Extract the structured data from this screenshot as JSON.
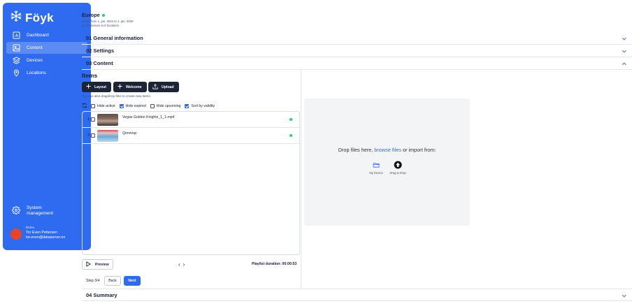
{
  "app": {
    "name": "Föyk"
  },
  "sidebar": {
    "items": [
      {
        "label": "Dashboard"
      },
      {
        "label": "Content"
      },
      {
        "label": "Devices"
      },
      {
        "label": "Locations"
      }
    ],
    "system": {
      "line1": "System",
      "line2": "management"
    },
    "user": {
      "org": "Demo",
      "name": "Tor Even Pettersen",
      "email": "tor.even@dataserver.no"
    }
  },
  "header": {
    "title": "Europe",
    "line1": "Active from 1. jan. 2024 to 1. jan. 2030",
    "line2": "on 10 devices in 8 locations"
  },
  "sections": {
    "s1": "01 General information",
    "s2": "02 Settings",
    "s3": "03 Content",
    "s4": "04 Summary"
  },
  "items": {
    "title": "Items",
    "buttons": {
      "layout": "Layout",
      "welcome": "Welcome",
      "upload": "Upload"
    },
    "helper": "You can also drag/drop files to create new items.",
    "filters": [
      {
        "label": "Hide active",
        "checked": false
      },
      {
        "label": "Hide expired",
        "checked": true
      },
      {
        "label": "Hide upcoming",
        "checked": false
      },
      {
        "label": "Sort by validity",
        "checked": true
      }
    ],
    "rows": [
      {
        "num": "1",
        "name": "Vegas Golden Knights_1_1.mp4"
      },
      {
        "num": "3",
        "name": "Qrevivqx"
      }
    ]
  },
  "footer": {
    "preview": "Preview",
    "prev": "‹",
    "next_page": "›",
    "duration": "Playlist duration: 00:00:53",
    "step": "Step 3/4",
    "back": "Back",
    "next": "Next"
  },
  "dropzone": {
    "prefix": "Drop files here,",
    "link": "browse files",
    "suffix": "or import from:",
    "sources": [
      {
        "label": "My Device"
      },
      {
        "label": "Drag & Drop"
      }
    ]
  },
  "colors": {
    "brand": "#2f6bf0",
    "dark": "#1c2536",
    "status": "#2ecc71",
    "avatar": "#e8442a"
  }
}
